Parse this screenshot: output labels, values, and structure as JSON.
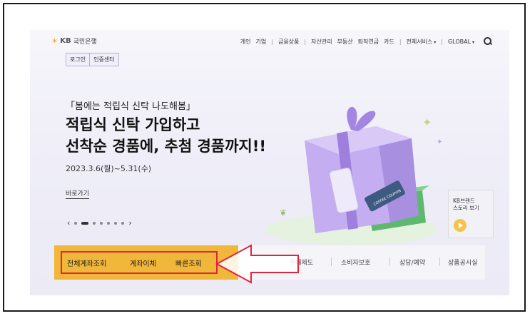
{
  "header": {
    "logo_text": "국민은행",
    "logo_kb": "KB",
    "nav": [
      "개인",
      "기업",
      "금융상품",
      "자산관리",
      "부동산",
      "퇴직연금",
      "카드",
      "전체서비스",
      "GLOBAL"
    ],
    "login": "로그인",
    "cert": "인증센터"
  },
  "hero": {
    "subtitle": "「봄에는 적립식 신탁 나도해봄」",
    "headline_line1": "적립식 신탁 가입하고",
    "headline_line2": "선착순 경품에, 추첨 경품까지!!",
    "period": "2023.3.6(월)~5.31(수)",
    "shortcut": "바로가기",
    "prev": "‹",
    "next": "›",
    "coupon_text": "COFFEE COUPON"
  },
  "brand_story": {
    "line1": "KB브랜드",
    "line2": "스토리 보기"
  },
  "quick": {
    "items": [
      "전체계좌조회",
      "계좌이체",
      "빠른조회"
    ],
    "right_items": [
      "우대제도",
      "소비자보호",
      "상담/예약",
      "상품공시실"
    ]
  },
  "colors": {
    "accent": "#f1b73a",
    "highlight": "#e0243b",
    "gift": "#b59ae8"
  }
}
